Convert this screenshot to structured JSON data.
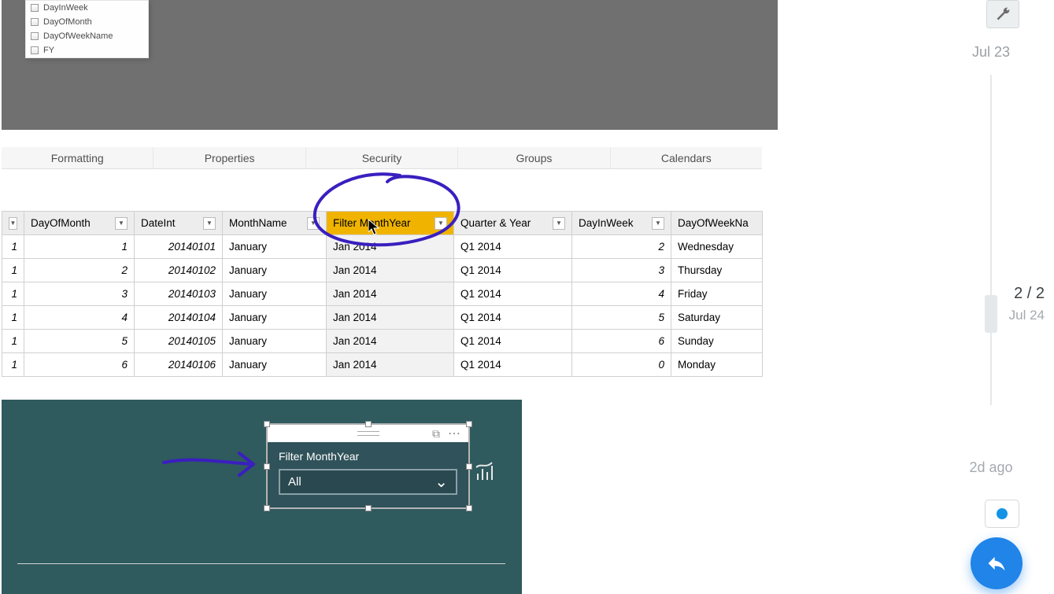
{
  "fields_panel": {
    "items": [
      "DayInWeek",
      "DayOfMonth",
      "DayOfWeekName",
      "FY"
    ]
  },
  "ribbon": {
    "tabs": [
      "Formatting",
      "Properties",
      "Security",
      "Groups",
      "Calendars"
    ]
  },
  "table": {
    "headers": {
      "row_num": "",
      "day_of_month": "DayOfMonth",
      "date_int": "DateInt",
      "month_name": "MonthName",
      "filter_month_year": "Filter MonthYear",
      "quarter_year": "Quarter & Year",
      "day_in_week": "DayInWeek",
      "day_of_week_name": "DayOfWeekNa"
    },
    "rows": [
      {
        "row": "1",
        "dom": "1",
        "dateint": "20140101",
        "mn": "January",
        "fmy": "Jan 2014",
        "qy": "Q1 2014",
        "diw": "2",
        "down": "Wednesday"
      },
      {
        "row": "1",
        "dom": "2",
        "dateint": "20140102",
        "mn": "January",
        "fmy": "Jan 2014",
        "qy": "Q1 2014",
        "diw": "3",
        "down": "Thursday"
      },
      {
        "row": "1",
        "dom": "3",
        "dateint": "20140103",
        "mn": "January",
        "fmy": "Jan 2014",
        "qy": "Q1 2014",
        "diw": "4",
        "down": "Friday"
      },
      {
        "row": "1",
        "dom": "4",
        "dateint": "20140104",
        "mn": "January",
        "fmy": "Jan 2014",
        "qy": "Q1 2014",
        "diw": "5",
        "down": "Saturday"
      },
      {
        "row": "1",
        "dom": "5",
        "dateint": "20140105",
        "mn": "January",
        "fmy": "Jan 2014",
        "qy": "Q1 2014",
        "diw": "6",
        "down": "Sunday"
      },
      {
        "row": "1",
        "dom": "6",
        "dateint": "20140106",
        "mn": "January",
        "fmy": "Jan 2014",
        "qy": "Q1 2014",
        "diw": "0",
        "down": "Monday"
      }
    ]
  },
  "slicer": {
    "title": "Filter MonthYear",
    "value": "All"
  },
  "timeline": {
    "top_date": "Jul 23",
    "current_count": "2 / 2",
    "current_date": "Jul 24",
    "bottom_label": "2d ago"
  },
  "icons": {
    "dropdown_glyph": "▼",
    "chevron_down": "⌄",
    "focus_mode": "⧉",
    "more": "⋯",
    "wrench": "🔧",
    "reply": "↶"
  }
}
